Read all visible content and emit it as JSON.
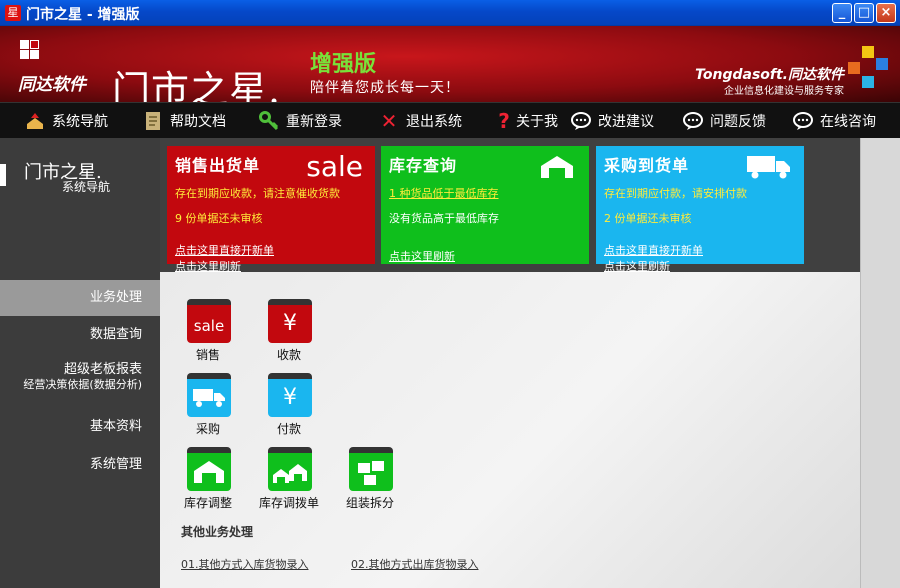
{
  "window": {
    "icon_char": "星",
    "title": "门市之星 - 增强版",
    "buttons": {
      "minimize": "_",
      "maximize": "□",
      "close": "×"
    }
  },
  "banner": {
    "brand": "同达软件",
    "product": "门市之星.",
    "edition": "增强版",
    "slogan": "陪伴着您成长每一天！",
    "company": "Tongdasoft.同达软件",
    "company_sub": "企业信息化建设与服务专家"
  },
  "toolbar": {
    "items": [
      {
        "label": "系统导航",
        "icon": "home-icon"
      },
      {
        "label": "帮助文档",
        "icon": "document-icon"
      },
      {
        "label": "重新登录",
        "icon": "key-icon"
      },
      {
        "label": "退出系统",
        "icon": "exit-icon"
      },
      {
        "label": "关于我",
        "icon": "question-icon"
      },
      {
        "label": "改进建议",
        "icon": "chat-icon"
      },
      {
        "label": "问题反馈",
        "icon": "chat-icon"
      },
      {
        "label": "在线咨询",
        "icon": "chat-icon"
      }
    ]
  },
  "sidebar": {
    "logo": "门市之星.",
    "logo_sub": "系统导航",
    "items": [
      {
        "label": "业务处理",
        "sub": ""
      },
      {
        "label": "数据查询",
        "sub": ""
      },
      {
        "label": "超级老板报表",
        "sub": "经营决策依据(数据分析)"
      },
      {
        "label": "基本资料",
        "sub": ""
      },
      {
        "label": "系统管理",
        "sub": ""
      }
    ]
  },
  "cards": {
    "sales": {
      "title": "销售出货单",
      "badge": "sale",
      "line1": "存在到期应收款，请注意催收货款",
      "line2": "9 份单据还未审核",
      "link1": "点击这里直接开新单",
      "link2": "点击这里刷新"
    },
    "stock": {
      "title": "库存查询",
      "line1": "1 种货品低于最低库存",
      "line2": "没有货品高于最低库存",
      "link1": "点击这里刷新"
    },
    "purchase": {
      "title": "采购到货单",
      "line1": "存在到期应付款，请安排付款",
      "line2": "2 份单据还未审核",
      "link1": "点击这里直接开新单",
      "link2": "点击这里刷新"
    }
  },
  "tiles": [
    {
      "label": "销售",
      "glyph": "sale",
      "icon": "sale-icon",
      "color": "#c2080e"
    },
    {
      "label": "收款",
      "glyph": "¥",
      "icon": "yen-icon",
      "color": "#c2080e"
    },
    {
      "label": "采购",
      "glyph": "🚚",
      "icon": "truck-icon",
      "color": "#1ab6ef"
    },
    {
      "label": "付款",
      "glyph": "¥",
      "icon": "yen-icon",
      "color": "#1ab6ef"
    },
    {
      "label": "库存调整",
      "glyph": "⌂",
      "icon": "warehouse-icon",
      "color": "#0fbf1c"
    },
    {
      "label": "库存调拨单",
      "glyph": "⌂⌂",
      "icon": "transfer-icon",
      "color": "#0fbf1c"
    },
    {
      "label": "组装拆分",
      "glyph": "▦",
      "icon": "boxes-icon",
      "color": "#0fbf1c"
    }
  ],
  "other": {
    "title": "其他业务处理",
    "link1": "01.其他方式入库货物录入",
    "link2": "02.其他方式出库货物录入"
  }
}
